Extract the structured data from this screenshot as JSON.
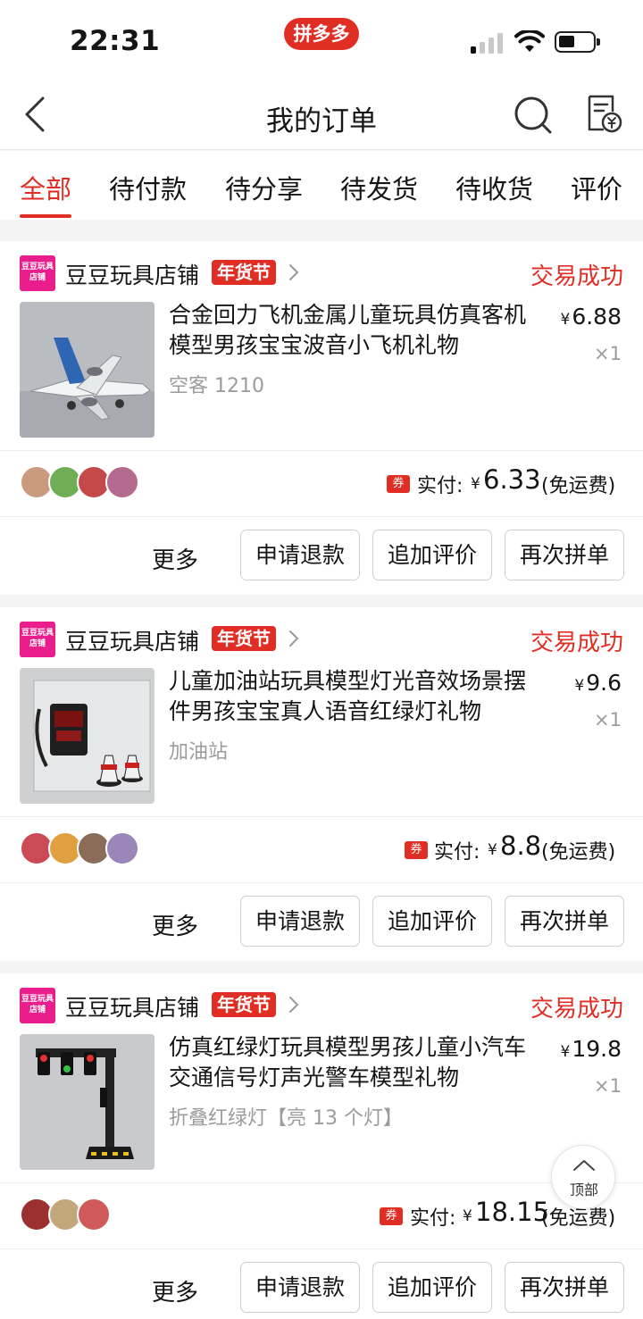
{
  "status_bar": {
    "time": "22:31",
    "app_badge": "拼多多"
  },
  "nav": {
    "title": "我的订单"
  },
  "tabs": [
    {
      "label": "全部",
      "active": true
    },
    {
      "label": "待付款"
    },
    {
      "label": "待分享"
    },
    {
      "label": "待发货"
    },
    {
      "label": "待收货"
    },
    {
      "label": "评价"
    }
  ],
  "orders": [
    {
      "store_logo_text": "豆豆玩具店铺",
      "store_name": "豆豆玩具店铺",
      "badge": "年货节",
      "status": "交易成功",
      "product_title": "合金回力飞机金属儿童玩具仿真客机模型男孩宝宝波音小飞机礼物",
      "spec": "空客 1210",
      "price_symbol": "¥",
      "price": "6.88",
      "qty": "×1",
      "coupon": "券",
      "paid_label": "实付:",
      "paid_symbol": "¥",
      "paid_amount": "6.33",
      "shipping_note": "(免运费)",
      "more": "更多",
      "buttons": [
        "申请退款",
        "追加评价",
        "再次拼单"
      ]
    },
    {
      "store_logo_text": "豆豆玩具店铺",
      "store_name": "豆豆玩具店铺",
      "badge": "年货节",
      "status": "交易成功",
      "product_title": "儿童加油站玩具模型灯光音效场景摆件男孩宝宝真人语音红绿灯礼物",
      "spec": "加油站",
      "price_symbol": "¥",
      "price": "9.6",
      "qty": "×1",
      "coupon": "券",
      "paid_label": "实付:",
      "paid_symbol": "¥",
      "paid_amount": "8.8",
      "shipping_note": "(免运费)",
      "more": "更多",
      "buttons": [
        "申请退款",
        "追加评价",
        "再次拼单"
      ]
    },
    {
      "store_logo_text": "豆豆玩具店铺",
      "store_name": "豆豆玩具店铺",
      "badge": "年货节",
      "status": "交易成功",
      "product_title": "仿真红绿灯玩具模型男孩儿童小汽车交通信号灯声光警车模型礼物",
      "spec": "折叠红绿灯【亮 13 个灯】",
      "price_symbol": "¥",
      "price": "19.8",
      "qty": "×1",
      "coupon": "券",
      "paid_label": "实付:",
      "paid_symbol": "¥",
      "paid_amount": "18.15",
      "shipping_note": "(免运费)",
      "more": "更多",
      "buttons": [
        "申请退款",
        "追加评价",
        "再次拼单"
      ]
    }
  ],
  "back_to_top": "顶部",
  "colors": {
    "accent": "#e02e24",
    "store_logo": "#e91e8c"
  }
}
